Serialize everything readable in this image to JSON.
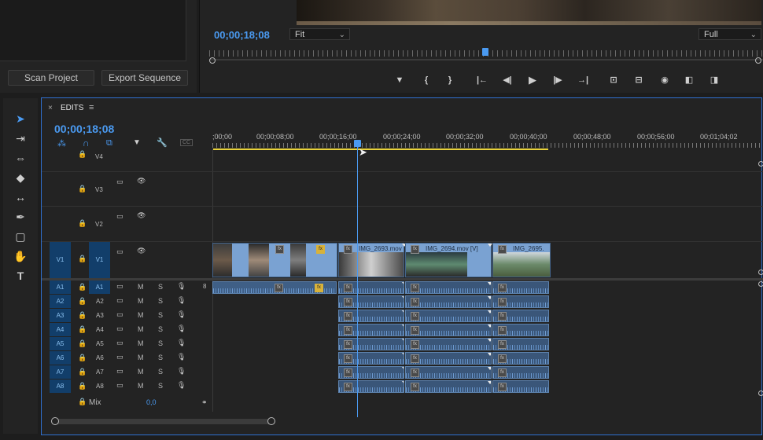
{
  "project": {
    "scan_label": "Scan Project",
    "export_label": "Export Sequence"
  },
  "program": {
    "timecode": "00;00;18;08",
    "zoom_select": "Fit",
    "quality_select": "Full",
    "controls": [
      "add-marker",
      "mark-in",
      "mark-out",
      "go-to-in",
      "step-back",
      "play",
      "step-forward",
      "go-to-out",
      "lift",
      "extract",
      "export-frame",
      "insert",
      "overwrite"
    ]
  },
  "timeline": {
    "close": "×",
    "tab_label": "EDITS",
    "menu": "≡",
    "timecode": "00;00;18;08",
    "ruler": [
      ";00;00",
      "00;00;08;00",
      "00;00;16;00",
      "00;00;24;00",
      "00;00;32;00",
      "00;00;40;00",
      "00;00;48;00",
      "00;00;56;00",
      "00;01;04;02"
    ],
    "video_tracks": [
      {
        "label": "V4",
        "src": ""
      },
      {
        "label": "V3",
        "src": ""
      },
      {
        "label": "V2",
        "src": ""
      },
      {
        "label": "V1",
        "src": "V1"
      }
    ],
    "audio_tracks": [
      {
        "src": "A1",
        "label": "A1"
      },
      {
        "src": "A2",
        "label": "A2"
      },
      {
        "src": "A3",
        "label": "A3"
      },
      {
        "src": "A4",
        "label": "A4"
      },
      {
        "src": "A5",
        "label": "A5"
      },
      {
        "src": "A6",
        "label": "A6"
      },
      {
        "src": "A7",
        "label": "A7"
      },
      {
        "src": "A8",
        "label": "A8"
      }
    ],
    "m": "M",
    "s": "S",
    "a1_level": "8",
    "mix_label": "Mix",
    "mix_value": "0,0",
    "clips": {
      "c1": "IMG_2693.mov",
      "c2": "IMG_2694.mov [V]",
      "c3": "IMG_2695."
    },
    "fx": "fx"
  },
  "colors": {
    "accent": "#4a9af1",
    "track_selected": "#123e6a",
    "video_clip": "#7aa2d2",
    "audio_clip": "#3a5679",
    "work_area": "#e8d23a"
  }
}
